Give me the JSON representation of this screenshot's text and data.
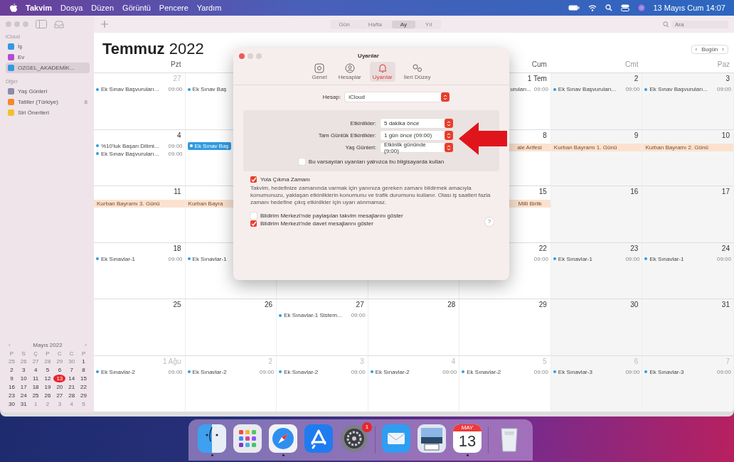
{
  "menu_bar": {
    "items": [
      "Takvim",
      "Dosya",
      "Düzen",
      "Görüntü",
      "Pencere",
      "Yardım"
    ],
    "clock": "13 Mayıs Cum 14:07"
  },
  "toolbar": {
    "views": [
      {
        "label": "Gün",
        "selected": false
      },
      {
        "label": "Hafta",
        "selected": false
      },
      {
        "label": "Ay",
        "selected": true
      },
      {
        "label": "Yıl",
        "selected": false
      }
    ],
    "search": {
      "placeholder": "Ara"
    }
  },
  "sidebar": {
    "groups": [
      {
        "title": "iCloud",
        "items": [
          {
            "label": "İş",
            "color": "#2f9be0",
            "selected": false
          },
          {
            "label": "Ev",
            "color": "#b04fd0",
            "selected": false
          },
          {
            "label": "OZGEL_AKADEMİK...",
            "color": "#2f9be0",
            "selected": true
          }
        ]
      },
      {
        "title": "Diğer",
        "items": [
          {
            "label": "Yaş Günleri",
            "color": "#8a8ea8",
            "selected": false
          },
          {
            "label": "Tatiller (Türkiye)",
            "color": "#f08a2c",
            "selected": false,
            "badge": "8"
          },
          {
            "label": "Siri Önerileri",
            "color": "#f2c12e",
            "selected": false
          }
        ]
      }
    ]
  },
  "mini_calendar": {
    "prev": "‹",
    "title": "Mayıs 2022",
    "next": "›",
    "weekdays": [
      "P",
      "S",
      "Ç",
      "P",
      "C",
      "C",
      "P"
    ],
    "weeks": [
      [
        {
          "d": "25",
          "other": true,
          "selected": false
        },
        {
          "d": "26",
          "other": true,
          "selected": false
        },
        {
          "d": "27",
          "other": true,
          "selected": false
        },
        {
          "d": "28",
          "other": true,
          "selected": false
        },
        {
          "d": "29",
          "other": true,
          "selected": false
        },
        {
          "d": "30",
          "other": true,
          "selected": false
        },
        {
          "d": "1",
          "other": false,
          "selected": false
        }
      ],
      [
        {
          "d": "2",
          "other": false,
          "selected": false
        },
        {
          "d": "3",
          "other": false,
          "selected": false
        },
        {
          "d": "4",
          "other": false,
          "selected": false
        },
        {
          "d": "5",
          "other": false,
          "selected": false
        },
        {
          "d": "6",
          "other": false,
          "selected": false
        },
        {
          "d": "7",
          "other": false,
          "selected": false
        },
        {
          "d": "8",
          "other": false,
          "selected": false
        }
      ],
      [
        {
          "d": "9",
          "other": false,
          "selected": false
        },
        {
          "d": "10",
          "other": false,
          "selected": false
        },
        {
          "d": "11",
          "other": false,
          "selected": false
        },
        {
          "d": "12",
          "other": false,
          "selected": false
        },
        {
          "d": "13",
          "other": false,
          "selected": true
        },
        {
          "d": "14",
          "other": false,
          "selected": false
        },
        {
          "d": "15",
          "other": false,
          "selected": false
        }
      ],
      [
        {
          "d": "16",
          "other": false,
          "selected": false
        },
        {
          "d": "17",
          "other": false,
          "selected": false
        },
        {
          "d": "18",
          "other": false,
          "selected": false
        },
        {
          "d": "19",
          "other": false,
          "selected": false
        },
        {
          "d": "20",
          "other": false,
          "selected": false
        },
        {
          "d": "21",
          "other": false,
          "selected": false
        },
        {
          "d": "22",
          "other": false,
          "selected": false
        }
      ],
      [
        {
          "d": "23",
          "other": false,
          "selected": false
        },
        {
          "d": "24",
          "other": false,
          "selected": false
        },
        {
          "d": "25",
          "other": false,
          "selected": false
        },
        {
          "d": "26",
          "other": false,
          "selected": false
        },
        {
          "d": "27",
          "other": false,
          "selected": false
        },
        {
          "d": "28",
          "other": false,
          "selected": false
        },
        {
          "d": "29",
          "other": false,
          "selected": false
        }
      ],
      [
        {
          "d": "30",
          "other": false,
          "selected": false
        },
        {
          "d": "31",
          "other": false,
          "selected": false
        },
        {
          "d": "1",
          "other": true,
          "selected": false
        },
        {
          "d": "2",
          "other": true,
          "selected": false
        },
        {
          "d": "3",
          "other": true,
          "selected": false
        },
        {
          "d": "4",
          "other": true,
          "selected": false
        },
        {
          "d": "5",
          "other": true,
          "selected": false
        }
      ]
    ]
  },
  "calendar": {
    "month": "Temmuz",
    "year": "2022",
    "nav": {
      "prev": "‹",
      "today": "Bugün",
      "next": "›"
    },
    "weekdays_left": [
      "Pzt"
    ],
    "weekdays_right": [
      "Cum",
      "Cmt",
      "Paz"
    ],
    "weeks": [
      {
        "left": [
          {
            "day": "27",
            "other": true,
            "events": [
              {
                "kind": "timed",
                "title": "Ek Sınav Başvuruları...",
                "time": "09:00"
              }
            ]
          },
          {
            "events": [
              {
                "kind": "timed",
                "title": "Ek Sınav Baş"
              }
            ]
          }
        ],
        "right": [
          {
            "day": "1 Tem",
            "other": false,
            "events": [
              {
                "kind": "cut",
                "title": "uruları...",
                "time": "09:00"
              }
            ]
          },
          {
            "day": "2",
            "other": false,
            "events": [
              {
                "kind": "timed",
                "title": "Ek Sınav Başvuruları...",
                "time": "09:00"
              }
            ]
          },
          {
            "day": "3",
            "other": false,
            "events": [
              {
                "kind": "timed",
                "title": "Ek Sınav Başvuruları...",
                "time": "09:00"
              }
            ]
          }
        ]
      },
      {
        "left": [
          {
            "day": "4",
            "other": false,
            "events": [
              {
                "kind": "timed",
                "title": "%10'luk Başarı Dilimi...",
                "time": "09:00"
              },
              {
                "kind": "timed",
                "title": "Ek Sınav Başvuruları...",
                "time": "09:00"
              }
            ]
          },
          {
            "events": [
              {
                "kind": "selected",
                "title": "Ek Sınav Baş"
              }
            ]
          }
        ],
        "right": [
          {
            "day": "8",
            "other": false,
            "events": [
              {
                "kind": "allday-cut",
                "title": "ale Arifesi"
              }
            ]
          },
          {
            "day": "9",
            "other": false,
            "events": [
              {
                "kind": "allday",
                "title": "Kurban Bayramı 1. Günü"
              }
            ]
          },
          {
            "day": "10",
            "other": false,
            "events": [
              {
                "kind": "allday",
                "title": "Kurban Bayramı 2. Günü"
              }
            ]
          }
        ]
      },
      {
        "left": [
          {
            "day": "11",
            "other": false,
            "events": [
              {
                "kind": "allday",
                "title": "Kurban Bayramı 3. Günü"
              }
            ]
          },
          {
            "events": [
              {
                "kind": "allday",
                "title": "Kurban Bayra"
              }
            ]
          }
        ],
        "right": [
          {
            "day": "15",
            "other": false,
            "events": [
              {
                "kind": "allday-cut",
                "title": "Milli Birlik"
              }
            ]
          },
          {
            "day": "16",
            "other": false
          },
          {
            "day": "17",
            "other": false
          }
        ]
      },
      {
        "left": [
          {
            "day": "18",
            "other": false,
            "events": [
              {
                "kind": "timed",
                "title": "Ek Sınavlar-1",
                "time": "09:00"
              }
            ]
          },
          {
            "events": [
              {
                "kind": "timed",
                "title": "Ek Sınavlar-1"
              }
            ]
          }
        ],
        "right": [
          {
            "day": "22",
            "other": false,
            "events": [
              {
                "kind": "cut",
                "time": "09:00"
              }
            ]
          },
          {
            "day": "23",
            "other": false,
            "events": [
              {
                "kind": "timed",
                "title": "Ek Sınavlar-1",
                "time": "09:00"
              }
            ]
          },
          {
            "day": "24",
            "other": false,
            "events": [
              {
                "kind": "timed",
                "title": "Ek Sınavlar-1",
                "time": "09:00"
              }
            ]
          }
        ]
      },
      {
        "cells": [
          {
            "day": "25",
            "other": false
          },
          {
            "day": "26",
            "other": false
          },
          {
            "day": "27",
            "other": false,
            "events": [
              {
                "kind": "timed",
                "title": "Ek Sınavlar-1 Sistem...",
                "time": "09:00"
              }
            ]
          },
          {
            "day": "28",
            "other": false
          },
          {
            "day": "29",
            "other": false
          },
          {
            "day": "30",
            "other": false
          },
          {
            "day": "31",
            "other": false
          }
        ]
      },
      {
        "cells": [
          {
            "day": "1 Ağu",
            "other": true,
            "events": [
              {
                "kind": "timed",
                "title": "Ek Sınavlar-2",
                "time": "09:00"
              }
            ]
          },
          {
            "day": "2",
            "other": true,
            "events": [
              {
                "kind": "timed",
                "title": "Ek Sınavlar-2",
                "time": "09:00"
              }
            ]
          },
          {
            "day": "3",
            "other": true,
            "events": [
              {
                "kind": "timed",
                "title": "Ek Sınavlar-2",
                "time": "09:00"
              }
            ]
          },
          {
            "day": "4",
            "other": true,
            "events": [
              {
                "kind": "timed",
                "title": "Ek Sınavlar-2",
                "time": "09:00"
              }
            ]
          },
          {
            "day": "5",
            "other": true,
            "events": [
              {
                "kind": "timed",
                "title": "Ek Sınavlar-2",
                "time": "09:00"
              }
            ]
          },
          {
            "day": "6",
            "other": true,
            "events": [
              {
                "kind": "timed",
                "title": "Ek Sınavlar-3",
                "time": "09:00"
              }
            ]
          },
          {
            "day": "7",
            "other": true,
            "events": [
              {
                "kind": "timed",
                "title": "Ek Sınavlar-3",
                "time": "09:00"
              }
            ]
          }
        ]
      }
    ]
  },
  "dialog": {
    "title": "Uyarılar",
    "tabs": [
      {
        "label": "Genel",
        "kind": "general",
        "selected": false
      },
      {
        "label": "Hesaplar",
        "kind": "accounts",
        "selected": false
      },
      {
        "label": "Uyarılar",
        "kind": "alerts",
        "selected": true
      },
      {
        "label": "İleri Düzey",
        "kind": "advanced",
        "selected": false
      }
    ],
    "account": {
      "label": "Hesap:",
      "value": "iCloud"
    },
    "alerts": [
      {
        "label": "Etkinlikler:",
        "value": "5 dakika önce"
      },
      {
        "label": "Tam Günlük Etkinlikler:",
        "value": "1 gün önce (09:00)"
      },
      {
        "label": "Yaş Günleri:",
        "value": "Etkinlik gününde (9:00)"
      }
    ],
    "local_only": {
      "label": "Bu varsayılan uyarıları yalnızca bu bilgisayarda kullan",
      "checked": false
    },
    "travel_time": {
      "label": "Yola Çıkma Zamanı",
      "checked": true,
      "description": "Takvim, hedefinize zamanında varmak için yanınıza gereken zamanı bildirmek amacıyla konumunuzu, yaklaşan etkinliklerin konumunu ve trafik durumunu kullanır. Olası iş saatleri fazla zamanı hedefine çıkış etkinlikler için uyarı alınmamaz."
    },
    "notifications": [
      {
        "label": "Bildirim Merkezi'nde paylaşılan takvim mesajlarını göster",
        "checked": false
      },
      {
        "label": "Bildirim Merkezi'nde davet mesajlarını göster",
        "checked": true
      }
    ],
    "help": "?"
  },
  "dock": {
    "items": [
      {
        "kind": "finder",
        "running": true
      },
      {
        "kind": "launchpad",
        "running": false
      },
      {
        "kind": "safari",
        "running": true
      },
      {
        "kind": "appstore",
        "running": false
      },
      {
        "kind": "settings",
        "running": false,
        "badge": "1"
      },
      {
        "kind": "separator"
      },
      {
        "kind": "mail",
        "running": false
      },
      {
        "kind": "preview",
        "running": false
      },
      {
        "kind": "calendar",
        "running": true,
        "month": "MAY",
        "day": "13"
      },
      {
        "kind": "separator"
      },
      {
        "kind": "trash",
        "running": false
      }
    ]
  }
}
